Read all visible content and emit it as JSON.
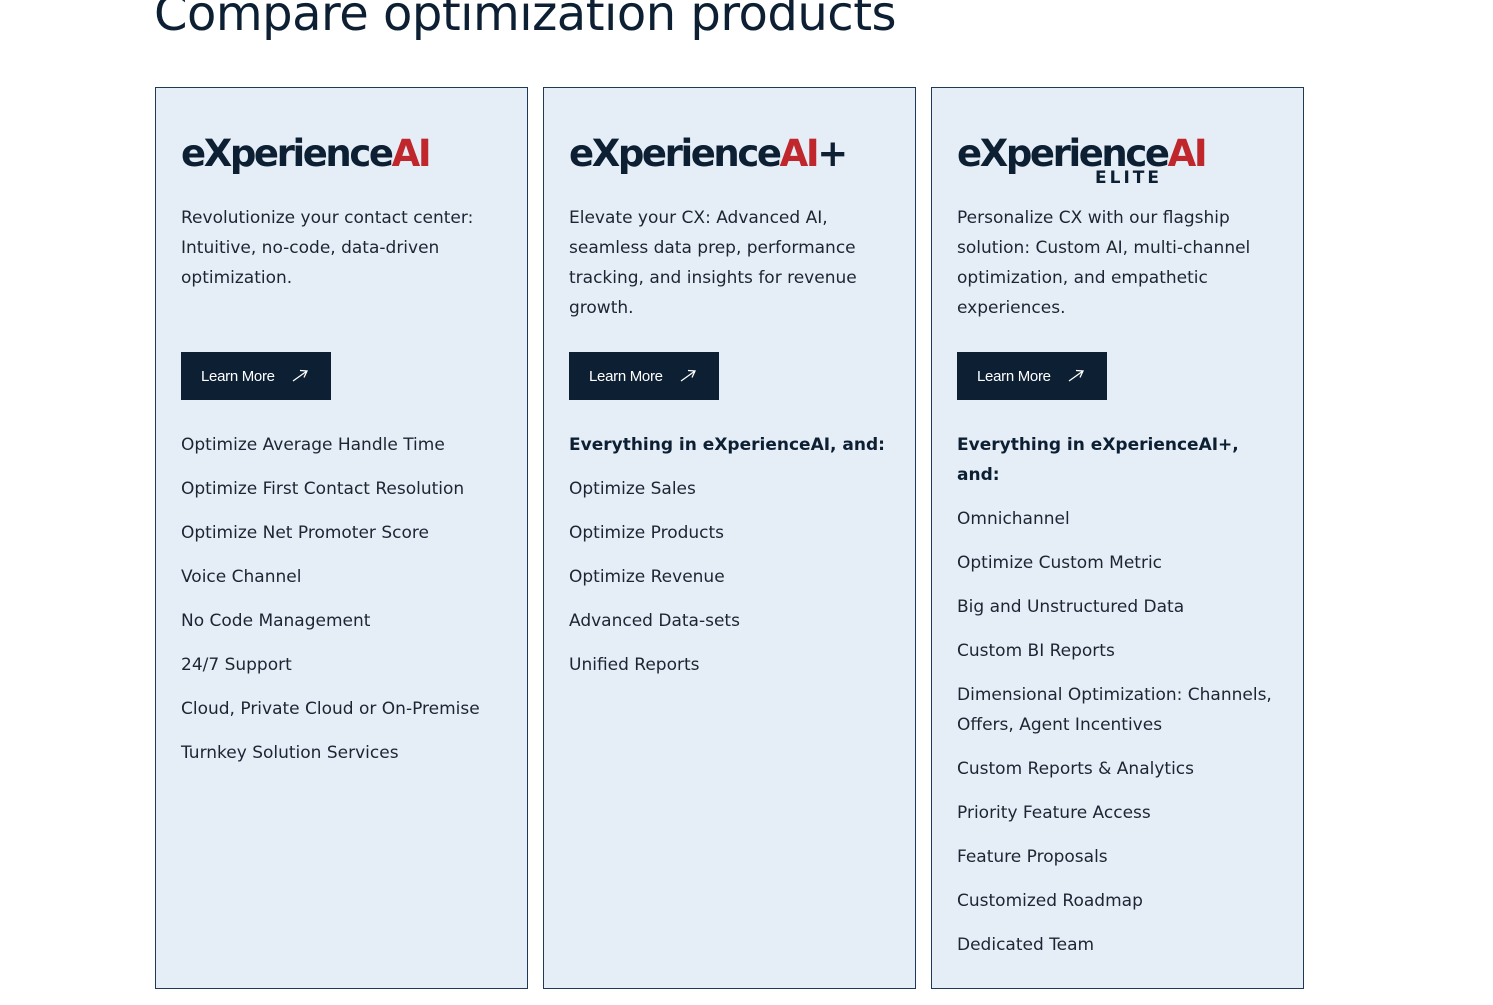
{
  "page": {
    "title": "Compare optimization products"
  },
  "colors": {
    "card_bg": "#e5eef6",
    "card_border": "#1f3a56",
    "button_bg": "#0d1f33",
    "brand_dark": "#0d1f33",
    "brand_red": "#c0272d"
  },
  "cards": [
    {
      "logo": {
        "prefix": "eXperience",
        "accent": "AI",
        "suffix": "",
        "sub": ""
      },
      "description": "Revolutionize your contact center: Intuitive, no-code, data-driven optimization.",
      "button_label": "Learn More",
      "button_icon": "arrow-up-right-icon",
      "lead": "",
      "features": [
        "Optimize Average Handle Time",
        "Optimize First Contact Resolution",
        "Optimize Net Promoter Score",
        "Voice Channel",
        "No Code Management",
        "24/7 Support",
        "Cloud, Private Cloud or On-Premise",
        "Turnkey Solution Services"
      ]
    },
    {
      "logo": {
        "prefix": "eXperience",
        "accent": "AI",
        "suffix": "+",
        "sub": ""
      },
      "description": "Elevate your CX: Advanced AI, seamless data prep, performance tracking, and insights for revenue growth.",
      "button_label": "Learn More",
      "button_icon": "arrow-up-right-icon",
      "lead": "Everything in eXperienceAI, and:",
      "features": [
        "Optimize Sales",
        "Optimize Products",
        "Optimize Revenue",
        "Advanced Data-sets",
        "Unified Reports"
      ]
    },
    {
      "logo": {
        "prefix": "eXperience",
        "accent": "AI",
        "suffix": "",
        "sub": "ELITE"
      },
      "description": "Personalize CX with our flagship solution: Custom AI, multi-channel optimization, and empathetic experiences.",
      "button_label": "Learn More",
      "button_icon": "arrow-up-right-icon",
      "lead": "Everything in eXperienceAI+, and:",
      "features": [
        "Omnichannel",
        "Optimize Custom Metric",
        "Big and Unstructured Data",
        "Custom BI Reports",
        "Dimensional Optimization: Channels, Offers, Agent Incentives",
        "Custom Reports & Analytics",
        "Priority Feature Access",
        "Feature Proposals",
        "Customized Roadmap",
        "Dedicated Team"
      ]
    }
  ]
}
